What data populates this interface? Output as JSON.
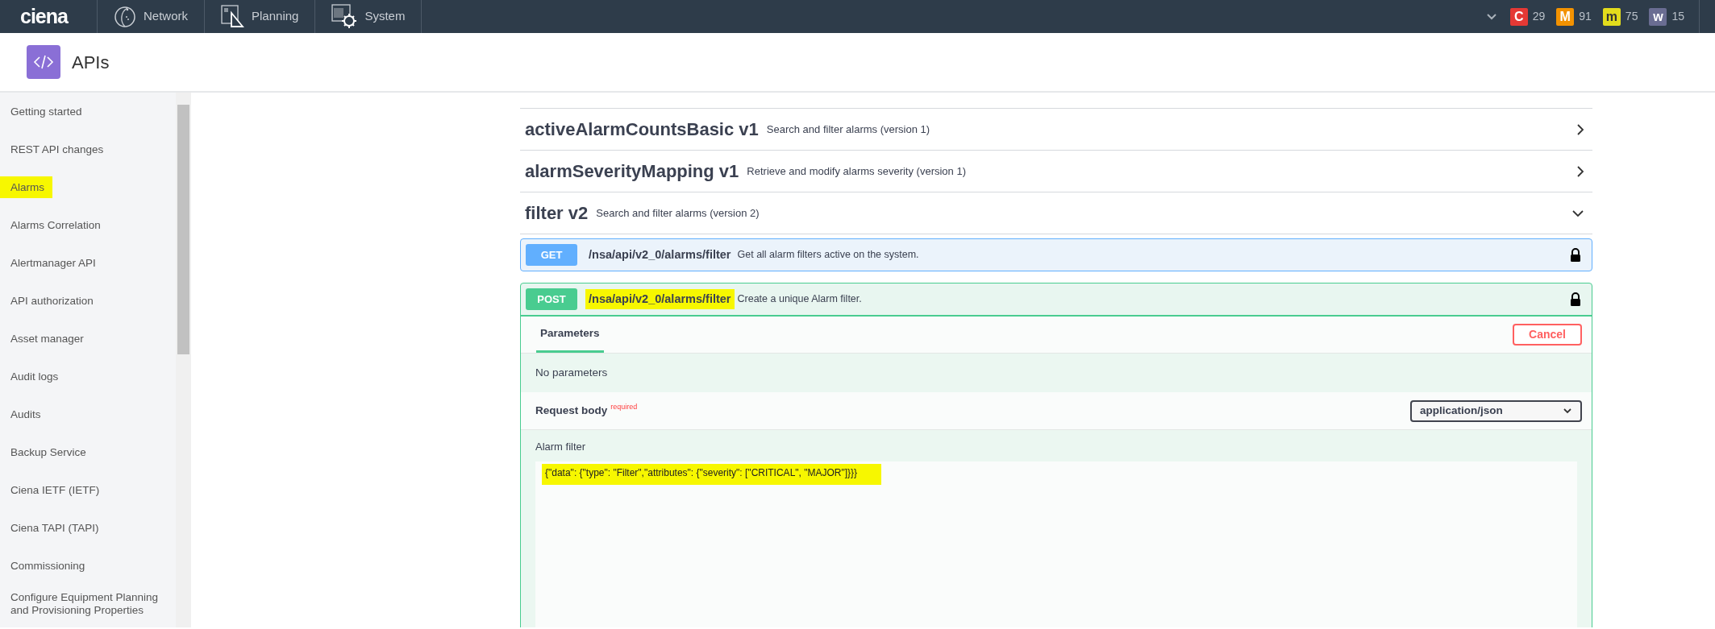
{
  "topbar": {
    "logo": "ciena",
    "nav": [
      {
        "label": "Network"
      },
      {
        "label": "Planning"
      },
      {
        "label": "System"
      }
    ],
    "alarm_counts": [
      {
        "letter": "C",
        "count": "29",
        "color": "#e53935"
      },
      {
        "letter": "M",
        "count": "91",
        "color": "#f39200"
      },
      {
        "letter": "m",
        "count": "75",
        "color": "#e3dc1c"
      },
      {
        "letter": "w",
        "count": "15",
        "color": "#6a6d92"
      }
    ]
  },
  "page_header": {
    "title": "APIs"
  },
  "sidebar": {
    "items": [
      {
        "label": "Getting started",
        "highlighted": false
      },
      {
        "label": "REST API changes",
        "highlighted": false
      },
      {
        "label": "Alarms",
        "highlighted": true
      },
      {
        "label": "Alarms Correlation",
        "highlighted": false
      },
      {
        "label": "Alertmanager API",
        "highlighted": false
      },
      {
        "label": "API authorization",
        "highlighted": false
      },
      {
        "label": "Asset manager",
        "highlighted": false
      },
      {
        "label": "Audit logs",
        "highlighted": false
      },
      {
        "label": "Audits",
        "highlighted": false
      },
      {
        "label": "Backup Service",
        "highlighted": false
      },
      {
        "label": "Ciena IETF (IETF)",
        "highlighted": false
      },
      {
        "label": "Ciena TAPI (TAPI)",
        "highlighted": false
      },
      {
        "label": "Commissioning",
        "highlighted": false
      },
      {
        "label": "Configure Equipment Planning and Provisioning Properties",
        "highlighted": false
      }
    ]
  },
  "api_groups": [
    {
      "name": "activeAlarmCountsBasic v1",
      "description": "Search and filter alarms (version 1)",
      "expanded": false
    },
    {
      "name": "alarmSeverityMapping v1",
      "description": "Retrieve and modify alarms severity (version 1)",
      "expanded": false
    },
    {
      "name": "filter v2",
      "description": "Search and filter alarms (version 2)",
      "expanded": true
    }
  ],
  "operations": [
    {
      "method": "GET",
      "path": "/nsa/api/v2_0/alarms/filter",
      "summary": "Get all alarm filters active on the system.",
      "highlighted": false,
      "expanded": false
    },
    {
      "method": "POST",
      "path": "/nsa/api/v2_0/alarms/filter",
      "summary": "Create a unique Alarm filter.",
      "highlighted": true,
      "expanded": true
    }
  ],
  "try_panel": {
    "tab": "Parameters",
    "cancel": "Cancel",
    "no_params": "No parameters",
    "request_body_label": "Request body",
    "required": "required",
    "content_type": "application/json",
    "body_title": "Alarm filter",
    "body_value": "{\"data\": {\"type\": \"Filter\",\"attributes\": {\"severity\": [\"CRITICAL\", \"MAJOR\"]}}}",
    "body_highlighted": true
  }
}
